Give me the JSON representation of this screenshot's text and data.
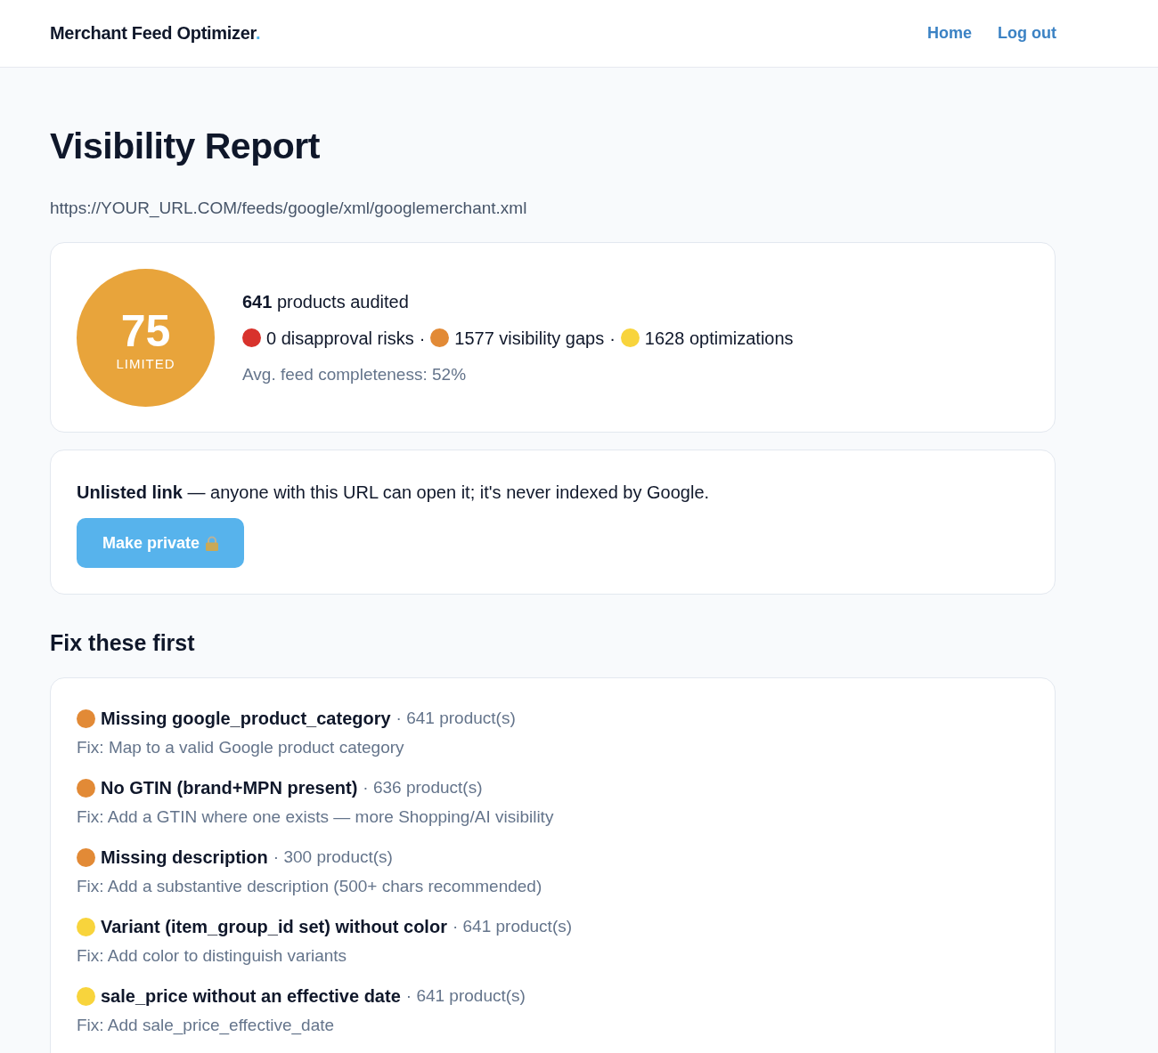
{
  "header": {
    "brand": "Merchant Feed Optimizer",
    "brand_mark": ".",
    "nav": [
      {
        "label": "Home"
      },
      {
        "label": "Log out"
      }
    ]
  },
  "title": "Visibility Report",
  "feed_url": "https://YOUR_URL.COM/feeds/google/xml/googlemerchant.xml",
  "score": {
    "value": "75",
    "grade": "LIMITED",
    "color": "#e8a43b",
    "audited": "**641** products audited",
    "separator": "·",
    "summary": [
      {
        "color": "#d8322c",
        "text": "0 disapproval risks"
      },
      {
        "color": "#e28a36",
        "text": "1577 visibility gaps"
      },
      {
        "color": "#f8d43c",
        "text": "1628 optimizations"
      }
    ],
    "completeness": "Avg. feed completeness: 52%"
  },
  "sharing": {
    "notice": "**Unlisted link** — anyone with this URL can open it; it's never indexed by Google.",
    "button": "Make private"
  },
  "fixes": {
    "heading": "Fix these first",
    "items": [
      {
        "color": "#e28a36",
        "title": "Missing google_product_category",
        "count": "· 641 product(s)",
        "fix": "Fix: Map to a valid Google product category"
      },
      {
        "color": "#e28a36",
        "title": "No GTIN (brand+MPN present)",
        "count": "· 636 product(s)",
        "fix": "Fix: Add a GTIN where one exists — more Shopping/AI visibility"
      },
      {
        "color": "#e28a36",
        "title": "Missing description",
        "count": "· 300 product(s)",
        "fix": "Fix: Add a substantive description (500+ chars recommended)"
      },
      {
        "color": "#f8d43c",
        "title": "Variant (item_group_id set) without color",
        "count": "· 641 product(s)",
        "fix": "Fix: Add color to distinguish variants"
      },
      {
        "color": "#f8d43c",
        "title": "sale_price without an effective date",
        "count": "· 641 product(s)",
        "fix": "Fix: Add sale_price_effective_date"
      }
    ]
  }
}
